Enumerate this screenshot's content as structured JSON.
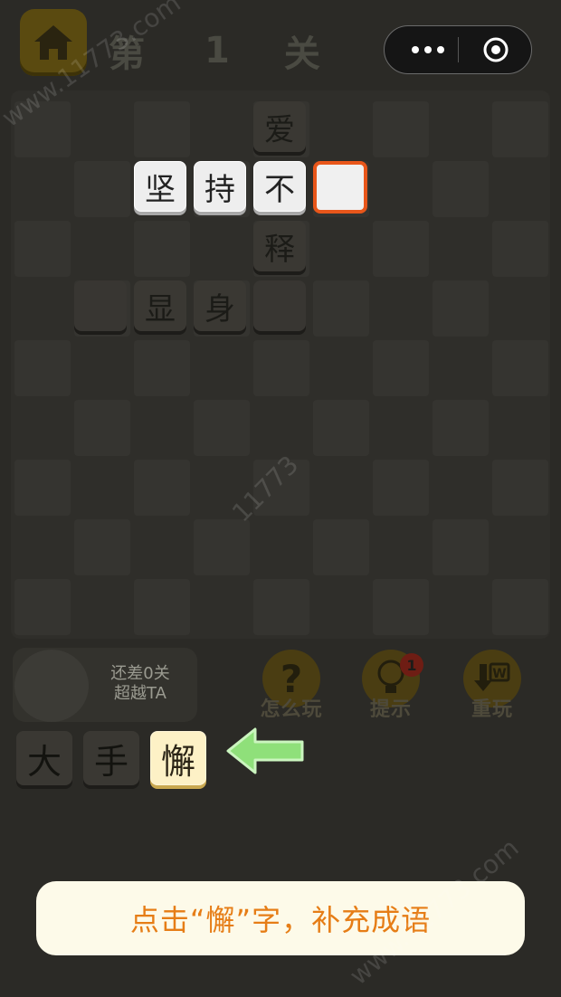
{
  "header": {
    "level_prefix": "第",
    "level_number": "1",
    "level_suffix": "关",
    "home_icon": "home-icon",
    "capsule_more_icon": "more-dots-icon",
    "capsule_close_icon": "target-close-icon"
  },
  "board": {
    "cross_vertical": {
      "top": "爱",
      "bottom": "释"
    },
    "row_one": [
      "坚",
      "持",
      "不",
      ""
    ],
    "row_two": [
      "",
      "显",
      "身",
      ""
    ]
  },
  "friend": {
    "line1": "还差0关",
    "line2": "超越TA"
  },
  "tools": [
    {
      "label": "怎么玩",
      "icon": "question-icon",
      "glyph": "?"
    },
    {
      "label": "提示",
      "icon": "lightbulb-icon",
      "badge": "1"
    },
    {
      "label": "重玩",
      "icon": "restart-icon",
      "glyph": "W"
    }
  ],
  "choices": [
    "大",
    "手",
    "懈"
  ],
  "hint": "点击“懈”字，补充成语",
  "watermarks": [
    "www.11773.com",
    "11773",
    "www.11773.com"
  ],
  "colors": {
    "selected_border": "#e8561a",
    "hint_text": "#e67d16",
    "arrow": "#8fe07a"
  }
}
